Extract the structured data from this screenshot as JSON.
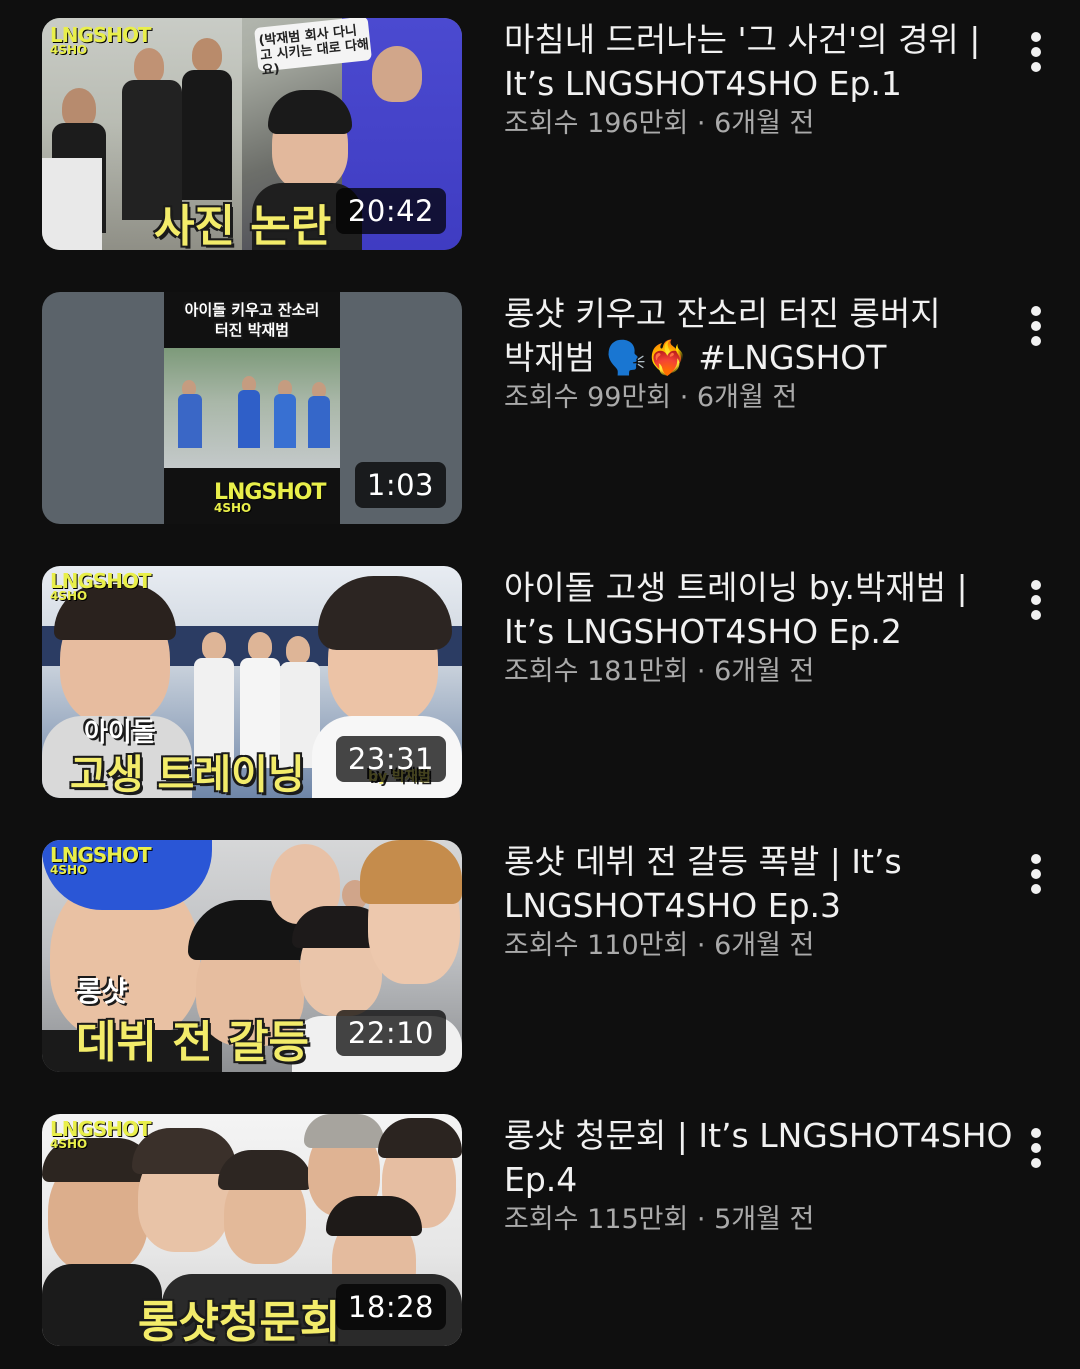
{
  "videos": [
    {
      "title": "마침내 드러나는 '그 사건'의 경위 | It’s LNGSHOT4SHO Ep.1",
      "views": "조회수 196만회",
      "age": "6개월 전",
      "duration": "20:42",
      "overlay_main": "사진 논란",
      "overlay_sub": "(박재범 회사 다니고 시키는 대로 다해요)",
      "logo": "LNGSHOT",
      "logo_sub": "4SHO"
    },
    {
      "title": "롱샷 키우고 잔소리 터진 롱버지 박재범 🗣️❤️‍🔥 #LNGSHOT",
      "views": "조회수 99만회",
      "age": "6개월 전",
      "duration": "1:03",
      "overlay_main": "아이돌 키우고 잔소리 터진 박재범",
      "logo": "LNGSHOT",
      "logo_sub": "4SHO"
    },
    {
      "title": "아이돌 고생 트레이닝 by.박재범 | It’s LNGSHOT4SHO Ep.2",
      "views": "조회수 181만회",
      "age": "6개월 전",
      "duration": "23:31",
      "overlay_sub": "아이돌",
      "overlay_main": "고생 트레이닝",
      "overlay_by": "by 박재범",
      "logo": "LNGSHOT",
      "logo_sub": "4SHO"
    },
    {
      "title": "롱샷 데뷔 전 갈등 폭발 | It’s LNGSHOT4SHO Ep.3",
      "views": "조회수 110만회",
      "age": "6개월 전",
      "duration": "22:10",
      "overlay_sub": "롱샷",
      "overlay_main": "데뷔 전 갈등",
      "logo": "LNGSHOT",
      "logo_sub": "4SHO"
    },
    {
      "title": "롱샷 청문회 | It’s LNGSHOT4SHO Ep.4",
      "views": "조회수 115만회",
      "age": "5개월 전",
      "duration": "18:28",
      "overlay_main": "롱샷청문회",
      "logo": "LNGSHOT",
      "logo_sub": "4SHO"
    }
  ],
  "separator": "·",
  "colors": {
    "background": "#0f0f0f",
    "title": "#f1f1f1",
    "meta": "#aaaaaa",
    "overlay_yellow": "#f3ec6a"
  },
  "icons": {
    "more": "vertical-ellipsis-icon"
  }
}
